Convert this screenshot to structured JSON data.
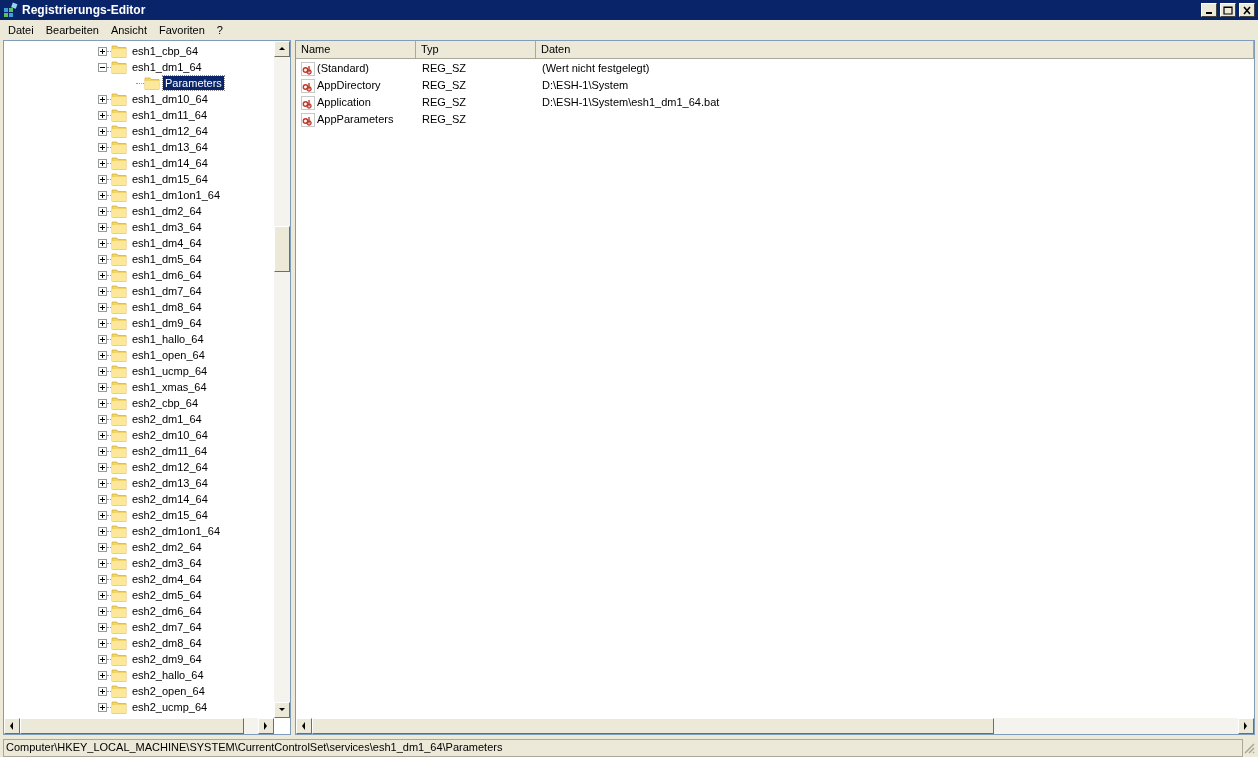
{
  "window": {
    "title": "Registrierungs-Editor"
  },
  "menu": [
    "Datei",
    "Bearbeiten",
    "Ansicht",
    "Favoriten",
    "?"
  ],
  "tree": [
    {
      "label": "esh1_cbp_64",
      "expanded": false,
      "selected": false
    },
    {
      "label": "esh1_dm1_64",
      "expanded": true,
      "selected": false,
      "children": [
        {
          "label": "Parameters",
          "selected": true
        }
      ]
    },
    {
      "label": "esh1_dm10_64",
      "expanded": false,
      "selected": false
    },
    {
      "label": "esh1_dm11_64",
      "expanded": false,
      "selected": false
    },
    {
      "label": "esh1_dm12_64",
      "expanded": false,
      "selected": false
    },
    {
      "label": "esh1_dm13_64",
      "expanded": false,
      "selected": false
    },
    {
      "label": "esh1_dm14_64",
      "expanded": false,
      "selected": false
    },
    {
      "label": "esh1_dm15_64",
      "expanded": false,
      "selected": false
    },
    {
      "label": "esh1_dm1on1_64",
      "expanded": false,
      "selected": false
    },
    {
      "label": "esh1_dm2_64",
      "expanded": false,
      "selected": false
    },
    {
      "label": "esh1_dm3_64",
      "expanded": false,
      "selected": false
    },
    {
      "label": "esh1_dm4_64",
      "expanded": false,
      "selected": false
    },
    {
      "label": "esh1_dm5_64",
      "expanded": false,
      "selected": false
    },
    {
      "label": "esh1_dm6_64",
      "expanded": false,
      "selected": false
    },
    {
      "label": "esh1_dm7_64",
      "expanded": false,
      "selected": false
    },
    {
      "label": "esh1_dm8_64",
      "expanded": false,
      "selected": false
    },
    {
      "label": "esh1_dm9_64",
      "expanded": false,
      "selected": false
    },
    {
      "label": "esh1_hallo_64",
      "expanded": false,
      "selected": false
    },
    {
      "label": "esh1_open_64",
      "expanded": false,
      "selected": false
    },
    {
      "label": "esh1_ucmp_64",
      "expanded": false,
      "selected": false
    },
    {
      "label": "esh1_xmas_64",
      "expanded": false,
      "selected": false
    },
    {
      "label": "esh2_cbp_64",
      "expanded": false,
      "selected": false
    },
    {
      "label": "esh2_dm1_64",
      "expanded": false,
      "selected": false
    },
    {
      "label": "esh2_dm10_64",
      "expanded": false,
      "selected": false
    },
    {
      "label": "esh2_dm11_64",
      "expanded": false,
      "selected": false
    },
    {
      "label": "esh2_dm12_64",
      "expanded": false,
      "selected": false
    },
    {
      "label": "esh2_dm13_64",
      "expanded": false,
      "selected": false
    },
    {
      "label": "esh2_dm14_64",
      "expanded": false,
      "selected": false
    },
    {
      "label": "esh2_dm15_64",
      "expanded": false,
      "selected": false
    },
    {
      "label": "esh2_dm1on1_64",
      "expanded": false,
      "selected": false
    },
    {
      "label": "esh2_dm2_64",
      "expanded": false,
      "selected": false
    },
    {
      "label": "esh2_dm3_64",
      "expanded": false,
      "selected": false
    },
    {
      "label": "esh2_dm4_64",
      "expanded": false,
      "selected": false
    },
    {
      "label": "esh2_dm5_64",
      "expanded": false,
      "selected": false
    },
    {
      "label": "esh2_dm6_64",
      "expanded": false,
      "selected": false
    },
    {
      "label": "esh2_dm7_64",
      "expanded": false,
      "selected": false
    },
    {
      "label": "esh2_dm8_64",
      "expanded": false,
      "selected": false
    },
    {
      "label": "esh2_dm9_64",
      "expanded": false,
      "selected": false
    },
    {
      "label": "esh2_hallo_64",
      "expanded": false,
      "selected": false
    },
    {
      "label": "esh2_open_64",
      "expanded": false,
      "selected": false
    },
    {
      "label": "esh2_ucmp_64",
      "expanded": false,
      "selected": false
    }
  ],
  "table": {
    "columns": [
      "Name",
      "Typ",
      "Daten"
    ],
    "rows": [
      {
        "name": "(Standard)",
        "type": "REG_SZ",
        "data": "(Wert nicht festgelegt)"
      },
      {
        "name": "AppDirectory",
        "type": "REG_SZ",
        "data": "D:\\ESH-1\\System"
      },
      {
        "name": "Application",
        "type": "REG_SZ",
        "data": "D:\\ESH-1\\System\\esh1_dm1_64.bat"
      },
      {
        "name": "AppParameters",
        "type": "REG_SZ"
      }
    ]
  },
  "status_bar": "Computer\\HKEY_LOCAL_MACHINE\\SYSTEM\\CurrentControlSet\\services\\esh1_dm1_64\\Parameters"
}
